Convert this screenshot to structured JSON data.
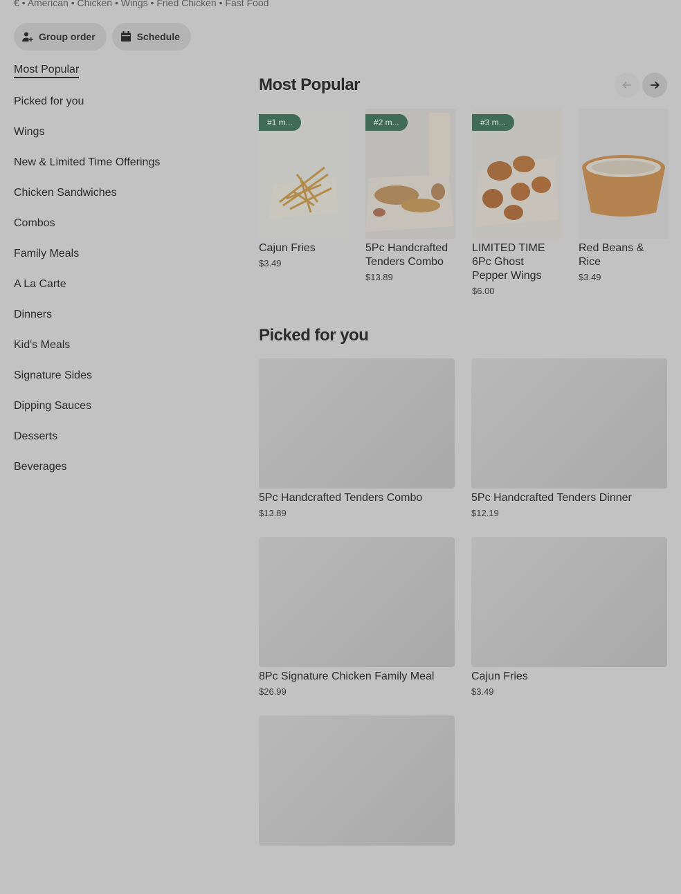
{
  "store": {
    "tags": "€ • American • Chicken • Wings • Fried Chicken • Fast Food"
  },
  "actions": {
    "group_order": "Group order",
    "schedule": "Schedule"
  },
  "sidebar": {
    "items": [
      {
        "label": "Most Popular",
        "active": true
      },
      {
        "label": "Picked for you"
      },
      {
        "label": "Wings"
      },
      {
        "label": "New & Limited Time Offerings"
      },
      {
        "label": "Chicken Sandwiches"
      },
      {
        "label": "Combos"
      },
      {
        "label": "Family Meals"
      },
      {
        "label": "A La Carte"
      },
      {
        "label": "Dinners"
      },
      {
        "label": "Kid's Meals"
      },
      {
        "label": "Signature Sides"
      },
      {
        "label": "Dipping Sauces"
      },
      {
        "label": "Desserts"
      },
      {
        "label": "Beverages"
      }
    ]
  },
  "most_popular": {
    "title": "Most Popular",
    "items": [
      {
        "badge": "#1 m...",
        "name": "Cajun Fries",
        "price": "$3.49",
        "icon": "fries-image"
      },
      {
        "badge": "#2 m...",
        "name": "5Pc Handcrafted Tenders Combo",
        "price": "$13.89",
        "icon": "tenders-combo-image"
      },
      {
        "badge": "#3 m...",
        "name": "LIMITED TIME 6Pc Ghost Pepper Wings",
        "price": "$6.00",
        "icon": "wings-image"
      },
      {
        "badge": "",
        "name": "Red Beans & Rice",
        "price": "$3.49",
        "icon": "red-beans-rice-image"
      }
    ]
  },
  "picked_for_you": {
    "title": "Picked for you",
    "items": [
      {
        "name": "5Pc Handcrafted Tenders Combo",
        "price": "$13.89"
      },
      {
        "name": "5Pc Handcrafted Tenders Dinner",
        "price": "$12.19"
      },
      {
        "name": "8Pc Signature Chicken Family Meal",
        "price": "$26.99"
      },
      {
        "name": "Cajun Fries",
        "price": "$3.49"
      },
      {
        "name": "",
        "price": ""
      }
    ]
  },
  "colors": {
    "overlay_bg": "#c2c2c2",
    "badge_bg": "#3f6b57"
  }
}
